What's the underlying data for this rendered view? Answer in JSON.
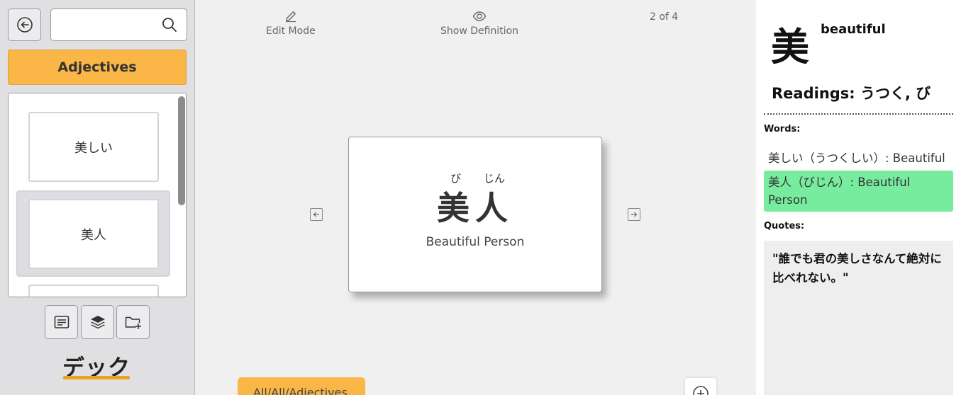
{
  "sidebar": {
    "search": {
      "value": "",
      "placeholder": ""
    },
    "deck_title": "Adjectives",
    "cards": [
      {
        "label": "美しい"
      },
      {
        "label": "美人"
      }
    ],
    "deck_label": "デック"
  },
  "main": {
    "edit_mode_label": "Edit Mode",
    "show_definition_label": "Show Definition",
    "counter": "2 of 4",
    "card": {
      "furigana": [
        "び",
        "じん"
      ],
      "word": "美人",
      "meaning": "Beautiful Person"
    },
    "path_tab": "All/All/Adjectives"
  },
  "panel": {
    "kanji": "美",
    "kanji_meaning": "beautiful",
    "readings": "Readings: うつく, び",
    "words_label": "Words:",
    "words": [
      {
        "text": "美しい（うつくしい）: Beautiful",
        "highlighted": false
      },
      {
        "text": "美人（びじん）: Beautiful Person",
        "highlighted": true
      }
    ],
    "quotes_label": "Quotes:",
    "quote": "\"誰でも君の美しさなんて絶対に比べれない。\""
  },
  "colors": {
    "accent": "#fab646",
    "highlight": "#78ec9e",
    "sidebar_bg": "#e0e0e2"
  },
  "icons": [
    "back-arrow-icon",
    "search-icon",
    "card-text-icon",
    "layers-icon",
    "folder-add-icon",
    "pencil-icon",
    "eye-icon",
    "arrow-left-icon",
    "arrow-right-icon",
    "plus-circle-icon"
  ]
}
